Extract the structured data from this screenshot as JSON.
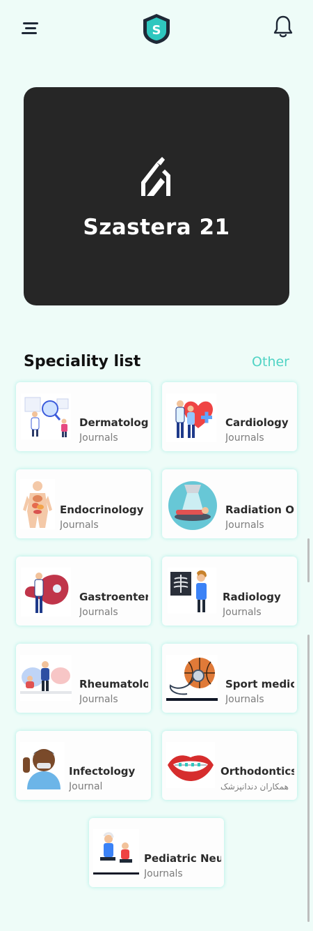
{
  "header": {
    "menu_icon": "menu-icon",
    "logo_letter": "S",
    "logo_color": "#2fc7bf",
    "notification_icon": "bell-icon"
  },
  "banner": {
    "title": "Szastera 21",
    "logo_icon": "szastera-logo-icon",
    "background": "#262626"
  },
  "specialities": {
    "title": "Speciality list",
    "other_label": "Other",
    "accent": "#4fd3c4",
    "items": [
      {
        "title": "Dermatology",
        "subtitle": "Journals",
        "icon": "dermatology-illustration"
      },
      {
        "title": "Cardiology",
        "subtitle": "Journals",
        "icon": "cardiology-illustration"
      },
      {
        "title": "Endocrinology",
        "subtitle": "Journals",
        "icon": "endocrinology-illustration"
      },
      {
        "title": "Radiation Oncology",
        "subtitle": "Journals",
        "icon": "radiation-oncology-illustration"
      },
      {
        "title": "Gastroenterology",
        "subtitle": "Journals",
        "icon": "gastroenterology-illustration"
      },
      {
        "title": "Radiology",
        "subtitle": "Journals",
        "icon": "radiology-illustration"
      },
      {
        "title": "Rheumatology",
        "subtitle": "Journals",
        "icon": "rheumatology-illustration"
      },
      {
        "title": "Sport medicine",
        "subtitle": "Journals",
        "icon": "sport-medicine-illustration"
      },
      {
        "title": "Infectology",
        "subtitle": "Journal",
        "icon": "infectology-illustration"
      },
      {
        "title": "Orthodontics",
        "subtitle": "همکاران دندانپزشک",
        "icon": "orthodontics-illustration"
      },
      {
        "title": "Pediatric Neurology",
        "subtitle": "Journals",
        "icon": "pediatric-neurology-illustration"
      }
    ]
  }
}
